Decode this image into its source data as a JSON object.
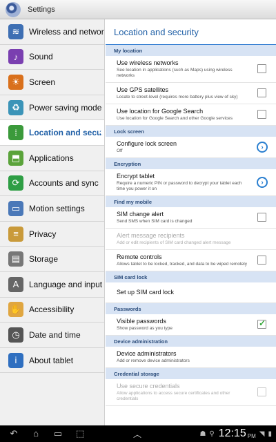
{
  "window": {
    "title": "Settings"
  },
  "sidebar": {
    "items": [
      {
        "label": "Wireless and networks",
        "icon": "wifi-icon",
        "color": "#3e6fb3",
        "glyph": "≋"
      },
      {
        "label": "Sound",
        "icon": "sound-icon",
        "color": "#7a3fb0",
        "glyph": "♪"
      },
      {
        "label": "Screen",
        "icon": "screen-icon",
        "color": "#d9701c",
        "glyph": "☀"
      },
      {
        "label": "Power saving mode",
        "icon": "power-saving-icon",
        "color": "#3b94b8",
        "glyph": "♻"
      },
      {
        "label": "Location and security",
        "icon": "location-security-icon",
        "color": "#3b9a3b",
        "glyph": "⁞"
      },
      {
        "label": "Applications",
        "icon": "applications-icon",
        "color": "#5aa33a",
        "glyph": "⬒"
      },
      {
        "label": "Accounts and sync",
        "icon": "accounts-sync-icon",
        "color": "#2e9e44",
        "glyph": "⟳"
      },
      {
        "label": "Motion settings",
        "icon": "motion-icon",
        "color": "#4a78b8",
        "glyph": "▭"
      },
      {
        "label": "Privacy",
        "icon": "privacy-icon",
        "color": "#c99a3a",
        "glyph": "≡"
      },
      {
        "label": "Storage",
        "icon": "storage-icon",
        "color": "#777777",
        "glyph": "▤"
      },
      {
        "label": "Language and input",
        "icon": "language-icon",
        "color": "#666666",
        "glyph": "A"
      },
      {
        "label": "Accessibility",
        "icon": "accessibility-icon",
        "color": "#e0a640",
        "glyph": "✋"
      },
      {
        "label": "Date and time",
        "icon": "clock-icon",
        "color": "#555555",
        "glyph": "◷"
      },
      {
        "label": "About tablet",
        "icon": "info-icon",
        "color": "#2f6fc0",
        "glyph": "i"
      }
    ],
    "selected_index": 4
  },
  "panel": {
    "title": "Location and security",
    "sections": [
      {
        "header": "My location",
        "rows": [
          {
            "title": "Use wireless networks",
            "subtitle": "See location in applications (such as Maps) using wireless networks",
            "control": "checkbox",
            "checked": false
          },
          {
            "title": "Use GPS satellites",
            "subtitle": "Locate to street-level (requires more battery plus view of sky)",
            "control": "checkbox",
            "checked": false
          },
          {
            "title": "Use location for Google Search",
            "subtitle": "Use location for Google Search and other Google services",
            "control": "checkbox",
            "checked": false
          }
        ]
      },
      {
        "header": "Lock screen",
        "rows": [
          {
            "title": "Configure lock screen",
            "subtitle": "Off",
            "control": "chevron"
          }
        ]
      },
      {
        "header": "Encryption",
        "rows": [
          {
            "title": "Encrypt tablet",
            "subtitle": "Require a numeric PIN or password to decrypt your tablet each time you power it on",
            "control": "chevron"
          }
        ]
      },
      {
        "header": "Find my mobile",
        "rows": [
          {
            "title": "SIM change alert",
            "subtitle": "Send SMS when SIM card is changed",
            "control": "checkbox",
            "checked": false
          },
          {
            "title": "Alert message recipients",
            "subtitle": "Add or edit recipients of SIM card changed alert message",
            "control": "none",
            "disabled": true
          },
          {
            "title": "Remote controls",
            "subtitle": "Allows tablet to be locked, tracked, and data to be wiped remotely",
            "control": "checkbox",
            "checked": false
          }
        ]
      },
      {
        "header": "SIM card lock",
        "rows": [
          {
            "title": "Set up SIM card lock",
            "subtitle": "",
            "control": "none"
          }
        ]
      },
      {
        "header": "Passwords",
        "rows": [
          {
            "title": "Visible passwords",
            "subtitle": "Show password as you type",
            "control": "checkbox",
            "checked": true
          }
        ]
      },
      {
        "header": "Device administration",
        "rows": [
          {
            "title": "Device administrators",
            "subtitle": "Add or remove device administrators",
            "control": "none"
          }
        ]
      },
      {
        "header": "Credential storage",
        "rows": [
          {
            "title": "Use secure credentials",
            "subtitle": "Allow applications to access secure certificates and other credentials",
            "control": "checkbox",
            "checked": false,
            "disabled": true
          }
        ]
      }
    ]
  },
  "navbar": {
    "buttons": [
      {
        "name": "back-button",
        "icon": "back-icon",
        "glyph": "↶"
      },
      {
        "name": "home-button",
        "icon": "home-icon",
        "glyph": "⌂"
      },
      {
        "name": "recent-apps-button",
        "icon": "recent-apps-icon",
        "glyph": "▭"
      },
      {
        "name": "screenshot-button",
        "icon": "screenshot-icon",
        "glyph": "⬚"
      }
    ],
    "clock": "12:15",
    "ampm": "PM"
  },
  "colors": {
    "accent": "#1f5fa6",
    "section_header_bg": "#d7e3f4",
    "checked": "#35a83a"
  }
}
